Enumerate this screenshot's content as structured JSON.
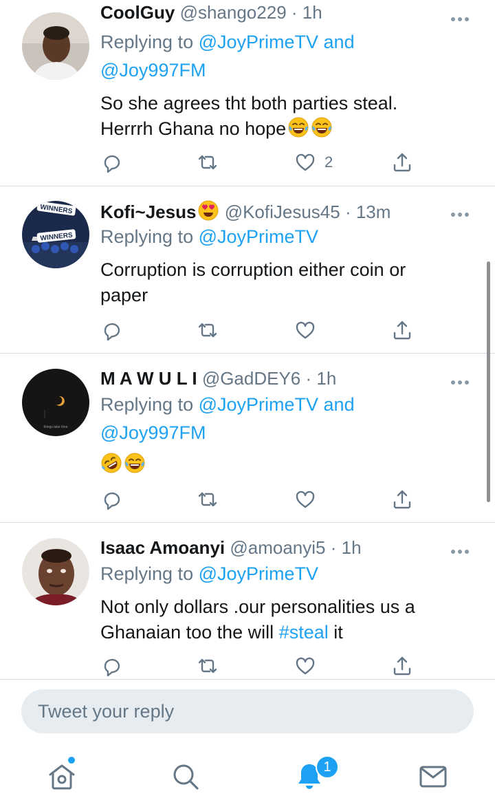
{
  "colors": {
    "accent": "#1da1f2",
    "secondary_text": "#657786",
    "primary_text": "#14171a",
    "divider": "#d9dee2",
    "composer_bg": "#e6ecf0"
  },
  "tweets": [
    {
      "name": "CoolGuy",
      "handle": "@shango229",
      "time": "· 1h",
      "replying_prefix": "Replying to",
      "replying_targets": "@JoyPrimeTV and",
      "replying_targets2": "@Joy997FM",
      "text_line1": "So she agrees tht both parties steal.",
      "text_line2": "Herrrh Ghana no hope",
      "emojis": [
        "face-with-tears-of-joy",
        "face-with-tears-of-joy"
      ],
      "like_count": "2"
    },
    {
      "name": "Kofi~Jesus",
      "name_emoji": "smiling-face-with-heart-eyes",
      "handle": "@KofiJesus45",
      "time": "· 13m",
      "replying_prefix": "Replying to",
      "replying_targets": "@JoyPrimeTV",
      "text_line1": "Corruption is corruption either coin or",
      "text_line2": "paper",
      "avatar_text": "WINNERS"
    },
    {
      "name": "M A W U L I",
      "handle": "@GadDEY6",
      "time": "· 1h",
      "replying_prefix": "Replying to",
      "replying_targets": "@JoyPrimeTV and",
      "replying_targets2": "@Joy997FM",
      "emojis": [
        "rolling-on-floor-laughing",
        "face-with-tears-of-joy"
      ],
      "avatar_text": "things take time"
    },
    {
      "name": "Isaac Amoanyi",
      "handle": "@amoanyi5",
      "time": "· 1h",
      "replying_prefix": "Replying to",
      "replying_targets": "@JoyPrimeTV",
      "text_line1": "Not only dollars .our personalities us a",
      "text_line2_pre": "Ghanaian too the will",
      "hashtag": "#steal",
      "text_line2_post": "it"
    }
  ],
  "action_icons": [
    "reply-icon",
    "retweet-icon",
    "like-icon",
    "share-icon"
  ],
  "composer": {
    "placeholder": "Tweet your reply"
  },
  "tabbar": {
    "icons": [
      "home-icon",
      "search-icon",
      "notifications-icon",
      "messages-icon"
    ],
    "notification_badge": "1"
  }
}
